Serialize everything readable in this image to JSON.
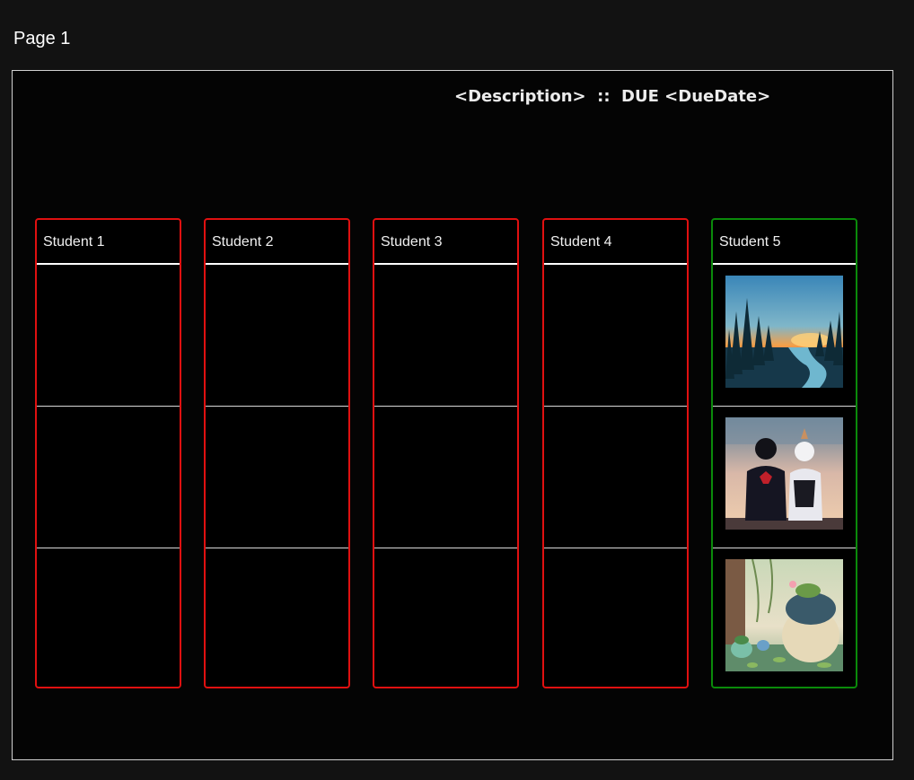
{
  "page": {
    "label": "Page 1"
  },
  "board": {
    "header": "<Description>  ::  DUE <DueDate>",
    "columns": [
      {
        "title": "Student 1",
        "status": "incomplete",
        "border_color": "#e01010"
      },
      {
        "title": "Student 2",
        "status": "incomplete",
        "border_color": "#e01010"
      },
      {
        "title": "Student 3",
        "status": "incomplete",
        "border_color": "#e01010"
      },
      {
        "title": "Student 4",
        "status": "incomplete",
        "border_color": "#e01010"
      },
      {
        "title": "Student 5",
        "status": "complete",
        "border_color": "#0a8a0a",
        "images": [
          "forest-sunset-image",
          "two-heroes-sitting-image",
          "pond-creatures-image"
        ]
      }
    ]
  }
}
